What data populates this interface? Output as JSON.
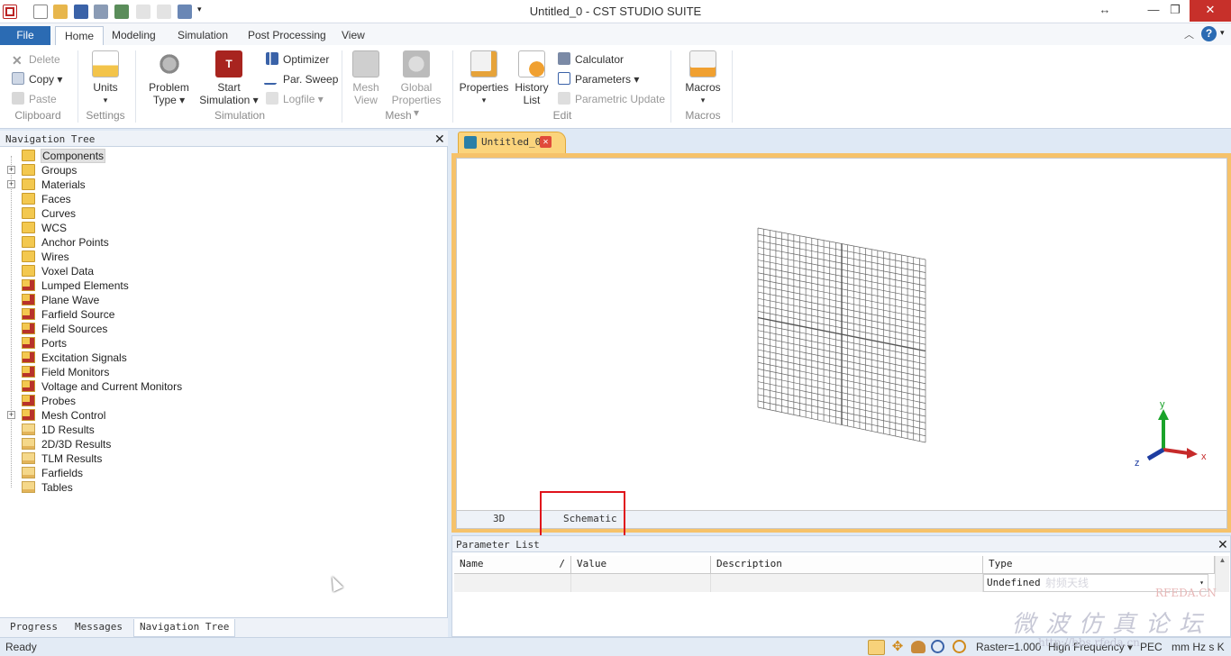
{
  "window": {
    "title": "Untitled_0 - CST STUDIO SUITE"
  },
  "ribbon_tabs": [
    "File",
    "Home",
    "Modeling",
    "Simulation",
    "Post Processing",
    "View"
  ],
  "clipboard": {
    "delete": "Delete",
    "copy": "Copy",
    "paste": "Paste",
    "label": "Clipboard"
  },
  "settings": {
    "units": "Units",
    "label": "Settings"
  },
  "simulation": {
    "problem_type_1": "Problem",
    "problem_type_2": "Type",
    "start_1": "Start",
    "start_2": "Simulation",
    "optimizer": "Optimizer",
    "par_sweep": "Par. Sweep",
    "logfile": "Logfile",
    "label": "Simulation"
  },
  "mesh": {
    "view_1": "Mesh",
    "view_2": "View",
    "global_1": "Global",
    "global_2": "Properties",
    "label": "Mesh"
  },
  "edit": {
    "properties": "Properties",
    "history_1": "History",
    "history_2": "List",
    "calculator": "Calculator",
    "parameters": "Parameters",
    "parametric_update": "Parametric Update",
    "label": "Edit"
  },
  "macros": {
    "button": "Macros",
    "label": "Macros"
  },
  "nav": {
    "title": "Navigation Tree",
    "items": [
      {
        "label": "Components",
        "icon": "folder-icon",
        "expandable": false,
        "selected": true
      },
      {
        "label": "Groups",
        "icon": "folder-icon",
        "expandable": true
      },
      {
        "label": "Materials",
        "icon": "folder-icon",
        "expandable": true
      },
      {
        "label": "Faces",
        "icon": "folder-icon",
        "expandable": false
      },
      {
        "label": "Curves",
        "icon": "folder-icon",
        "expandable": false
      },
      {
        "label": "WCS",
        "icon": "folder-icon",
        "expandable": false
      },
      {
        "label": "Anchor Points",
        "icon": "folder-icon",
        "expandable": false
      },
      {
        "label": "Wires",
        "icon": "folder-icon",
        "expandable": false
      },
      {
        "label": "Voxel Data",
        "icon": "folder-icon",
        "expandable": false
      },
      {
        "label": "Lumped Elements",
        "icon": "gear-folder-icon",
        "expandable": false
      },
      {
        "label": "Plane Wave",
        "icon": "gear-folder-icon",
        "expandable": false
      },
      {
        "label": "Farfield Source",
        "icon": "gear-folder-icon",
        "expandable": false
      },
      {
        "label": "Field Sources",
        "icon": "gear-folder-icon",
        "expandable": false
      },
      {
        "label": "Ports",
        "icon": "gear-folder-icon",
        "expandable": false
      },
      {
        "label": "Excitation Signals",
        "icon": "gear-folder-icon",
        "expandable": false
      },
      {
        "label": "Field Monitors",
        "icon": "gear-folder-icon",
        "expandable": false
      },
      {
        "label": "Voltage and Current Monitors",
        "icon": "gear-folder-icon",
        "expandable": false
      },
      {
        "label": "Probes",
        "icon": "gear-folder-icon",
        "expandable": false
      },
      {
        "label": "Mesh Control",
        "icon": "gear-folder-icon",
        "expandable": true
      },
      {
        "label": "1D Results",
        "icon": "results-folder-icon",
        "expandable": false
      },
      {
        "label": "2D/3D Results",
        "icon": "results-folder-icon",
        "expandable": false
      },
      {
        "label": "TLM Results",
        "icon": "results-folder-icon",
        "expandable": false
      },
      {
        "label": "Farfields",
        "icon": "results-folder-icon",
        "expandable": false
      },
      {
        "label": "Tables",
        "icon": "results-folder-icon",
        "expandable": false
      }
    ]
  },
  "bottom_tabs": [
    "Progress",
    "Messages",
    "Navigation Tree"
  ],
  "document": {
    "tab": "Untitled_0",
    "view_tabs": [
      "3D",
      "Schematic"
    ],
    "axes": {
      "x": "x",
      "y": "y",
      "z": "z"
    }
  },
  "param_list": {
    "title": "Parameter List",
    "columns": [
      "Name",
      "Value",
      "Description",
      "Type"
    ],
    "sort_marker": "/",
    "type_value": "Undefined"
  },
  "status": {
    "ready": "Ready",
    "raster": "Raster=1.000",
    "frequency": "High Frequency",
    "boundary": "PEC",
    "units": "mm Hz s K"
  },
  "watermark": {
    "brand": "RFEDA.CN",
    "chinese": "微波仿真论坛",
    "site": "http://bbs.rfeda.cn",
    "small": "射频天线"
  },
  "colors": {
    "accent": "#2b6bb3",
    "doc_tab": "#fbd47c",
    "doc_frame": "#f6c26a",
    "highlight_box": "#e0131b"
  }
}
